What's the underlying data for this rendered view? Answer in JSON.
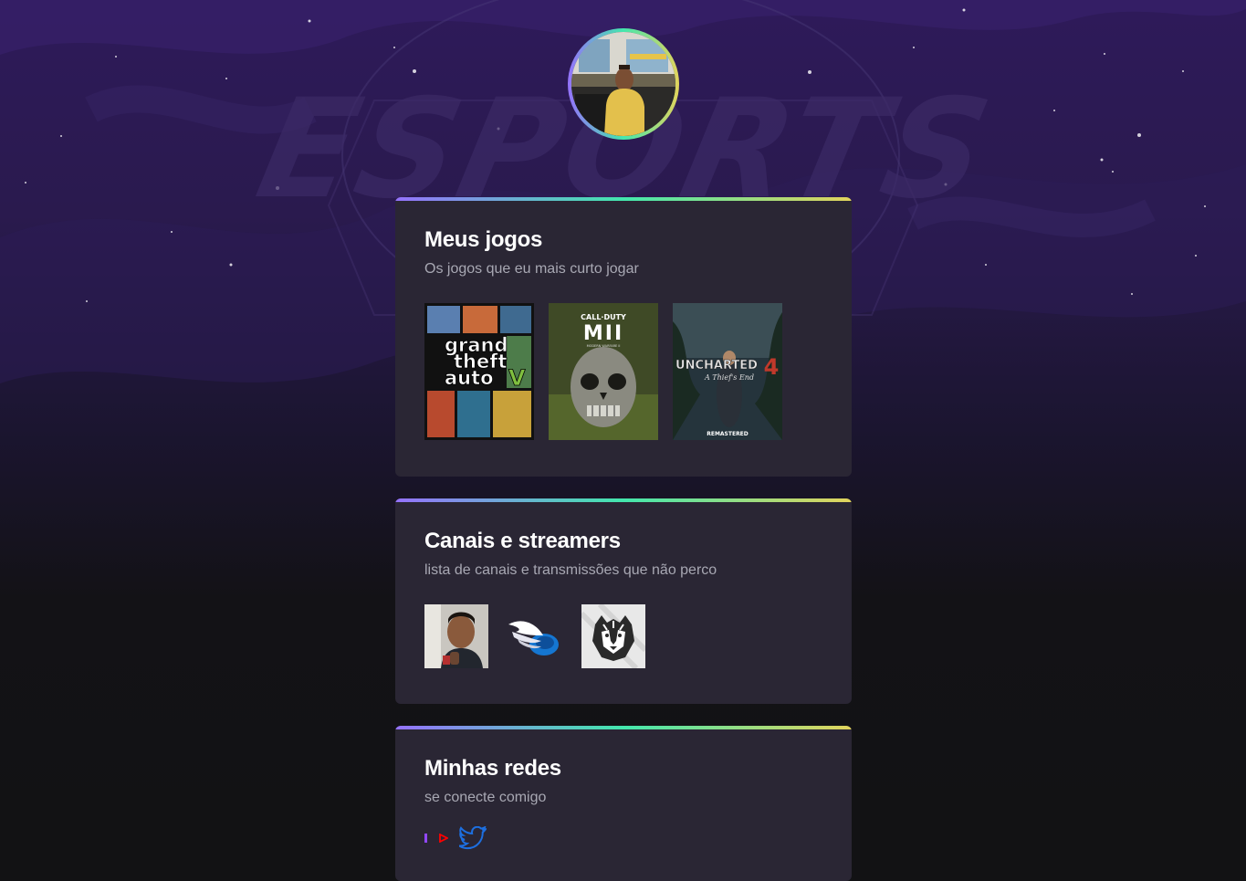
{
  "profile": {
    "avatar_alt": "profile-photo"
  },
  "background": {
    "watermark": "ESPORTS"
  },
  "games": {
    "title": "Meus jogos",
    "subtitle": "Os jogos que eu mais curto jogar",
    "covers": [
      {
        "name": "game-cover-gta-v",
        "lines": [
          "grand",
          "theft",
          "auto"
        ],
        "badge": "V"
      },
      {
        "name": "game-cover-cod-mw2",
        "top": "CALL·DUTY",
        "logo": "MII",
        "sub": "MODERN WARFARE II"
      },
      {
        "name": "game-cover-uncharted-4",
        "logo": "UNCHARTED",
        "num": "4",
        "tag": "A Thief's End",
        "foot": "REMASTERED"
      }
    ]
  },
  "streamers": {
    "title": "Canais e streamers",
    "subtitle": "lista de canais e transmissões que não perco"
  },
  "networks": {
    "title": "Minhas redes",
    "subtitle": "se conecte comigo",
    "icons": [
      "twitch-icon",
      "youtube-icon",
      "twitter-icon"
    ]
  },
  "colors": {
    "gradient": [
      "#9572fc",
      "#43e7ad",
      "#e2d45c"
    ],
    "card": "#2a2634",
    "page": "#121214"
  }
}
